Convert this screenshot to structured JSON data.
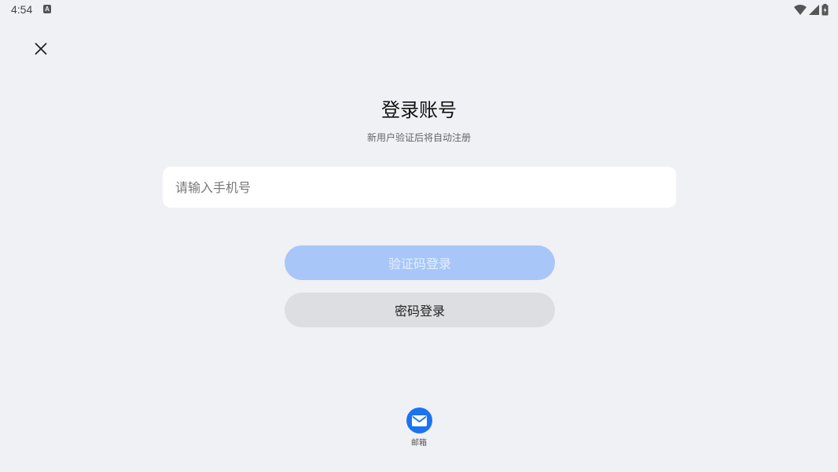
{
  "status_bar": {
    "time": "4:54",
    "app_icon_letter": "A",
    "icons": [
      "wifi-icon",
      "signal-icon",
      "battery-icon"
    ]
  },
  "close_icon": "close-icon",
  "title": "登录账号",
  "subtitle": "新用户验证后将自动注册",
  "phone_input": {
    "placeholder": "请输入手机号",
    "value": ""
  },
  "buttons": {
    "code_login": "验证码登录",
    "password_login": "密码登录"
  },
  "other_login": {
    "email_label": "邮箱",
    "email_icon": "mail-icon"
  },
  "colors": {
    "background": "#f0f1f5",
    "primary_disabled": "#a8c7f8",
    "secondary_button": "#dddee2",
    "email_icon_bg": "#1b73f0"
  }
}
